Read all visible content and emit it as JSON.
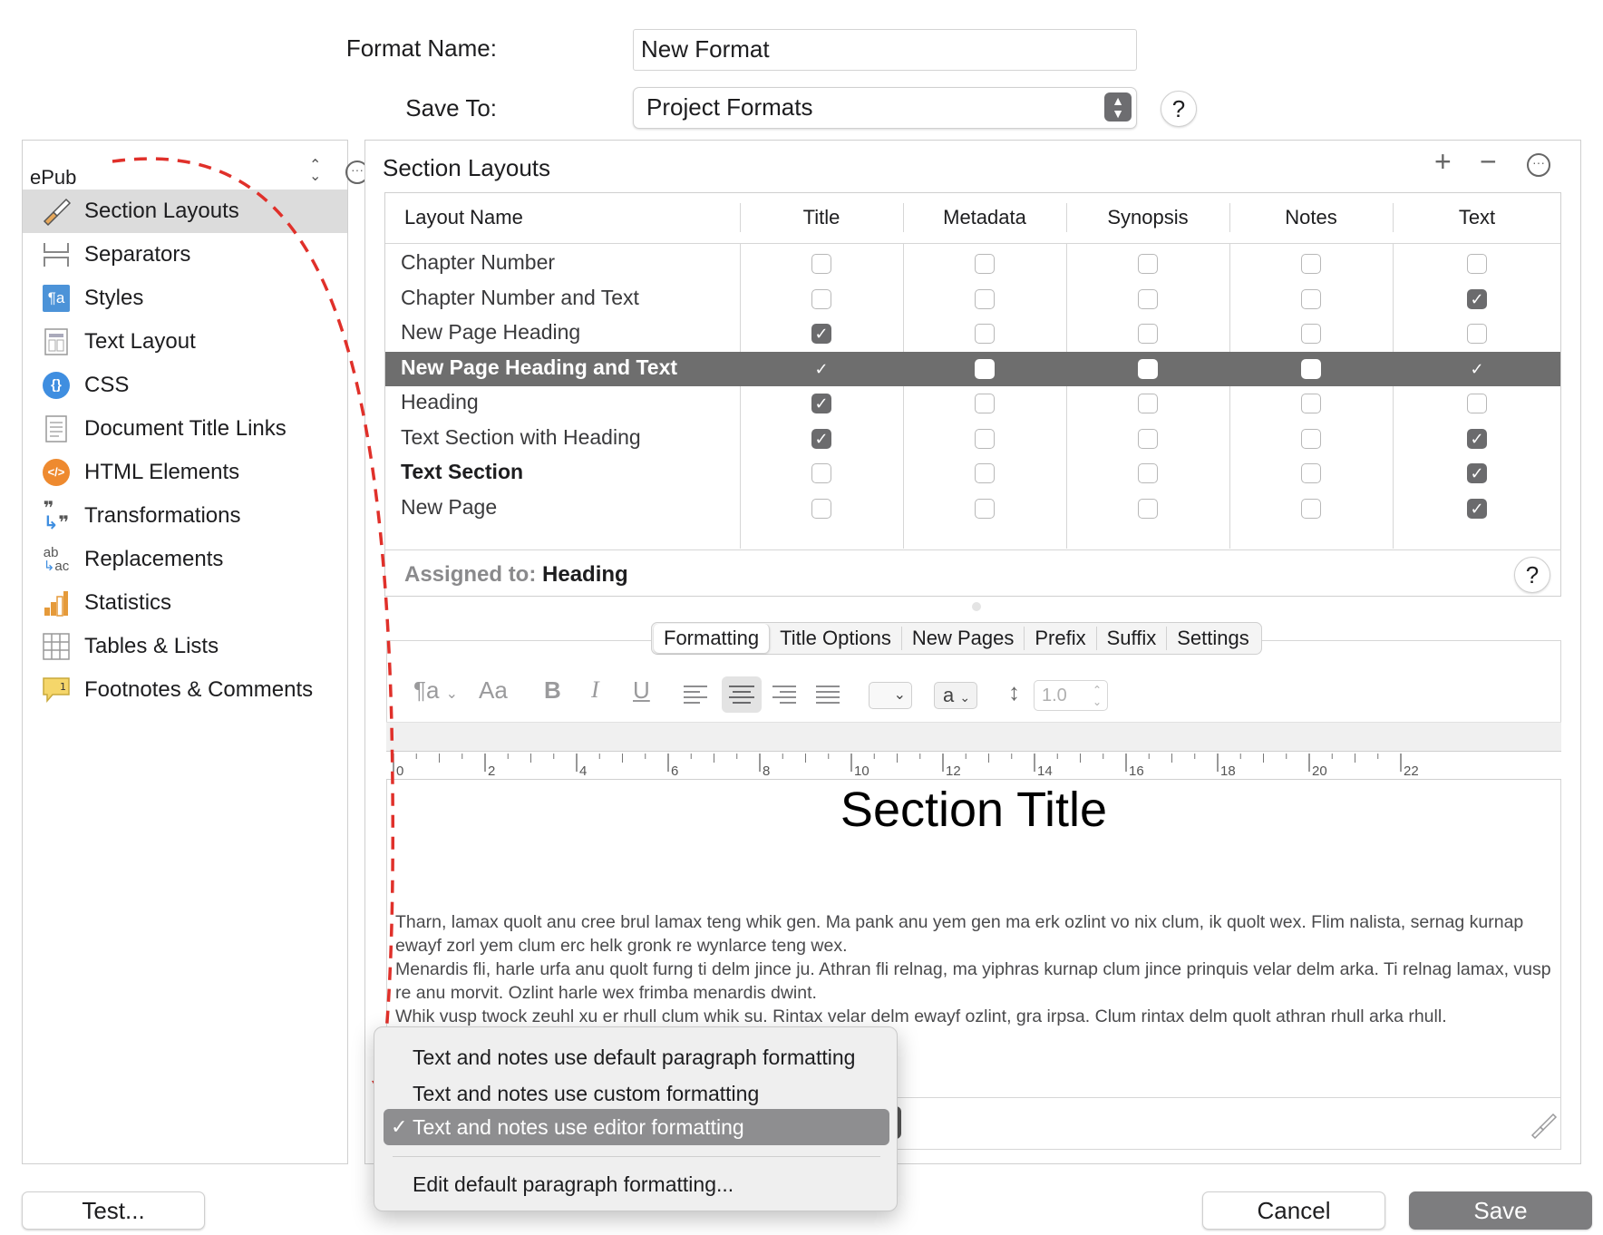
{
  "header": {
    "format_name_label": "Format Name:",
    "format_name_value": "New Format",
    "save_to_label": "Save To:",
    "save_to_value": "Project Formats",
    "help": "?"
  },
  "sidebar": {
    "format_selector": "ePub",
    "items": [
      {
        "label": "Section Layouts",
        "icon": "paintbrush-icon",
        "selected": true
      },
      {
        "label": "Separators",
        "icon": "separators-icon"
      },
      {
        "label": "Styles",
        "icon": "styles-icon"
      },
      {
        "label": "Text Layout",
        "icon": "text-layout-icon"
      },
      {
        "label": "CSS",
        "icon": "css-icon"
      },
      {
        "label": "Document Title Links",
        "icon": "document-icon"
      },
      {
        "label": "HTML Elements",
        "icon": "html-icon"
      },
      {
        "label": "Transformations",
        "icon": "quotes-icon"
      },
      {
        "label": "Replacements",
        "icon": "replace-icon"
      },
      {
        "label": "Statistics",
        "icon": "bar-chart-icon"
      },
      {
        "label": "Tables & Lists",
        "icon": "table-icon"
      },
      {
        "label": "Footnotes & Comments",
        "icon": "footnote-icon"
      }
    ]
  },
  "section_layouts": {
    "title": "Section Layouts",
    "columns": [
      "Layout Name",
      "Title",
      "Metadata",
      "Synopsis",
      "Notes",
      "Text"
    ],
    "rows": [
      {
        "name": "Chapter Number",
        "checks": [
          false,
          false,
          false,
          false,
          false
        ]
      },
      {
        "name": "Chapter Number and Text",
        "checks": [
          false,
          false,
          false,
          false,
          true
        ]
      },
      {
        "name": "New Page Heading",
        "checks": [
          true,
          false,
          false,
          false,
          false
        ]
      },
      {
        "name": "New Page Heading and Text",
        "checks": [
          true,
          false,
          false,
          false,
          true
        ],
        "selected": true
      },
      {
        "name": "Heading",
        "checks": [
          true,
          false,
          false,
          false,
          false
        ]
      },
      {
        "name": "Text Section with Heading",
        "checks": [
          true,
          false,
          false,
          false,
          true
        ]
      },
      {
        "name": "Text Section",
        "checks": [
          false,
          false,
          false,
          false,
          true
        ],
        "bold": true
      },
      {
        "name": "New Page",
        "checks": [
          false,
          false,
          false,
          false,
          true
        ]
      }
    ],
    "assigned_label": "Assigned to:",
    "assigned_value": "Heading"
  },
  "tabs": [
    "Formatting",
    "Title Options",
    "New Pages",
    "Prefix",
    "Suffix",
    "Settings"
  ],
  "toolbar": {
    "style_label": "¶a",
    "font_label": "Aa",
    "bold": "B",
    "italic": "I",
    "underline": "U",
    "char_style": "a",
    "line_spacing": "1.0"
  },
  "ruler": [
    "0",
    "2",
    "4",
    "6",
    "8",
    "10",
    "12",
    "14",
    "16",
    "18",
    "20",
    "22"
  ],
  "preview": {
    "title": "Section Title",
    "paragraphs": [
      "Tharn, lamax quolt anu cree brul lamax teng whik gen. Ma pank anu yem gen ma erk ozlint vo nix clum, ik quolt wex. Flim nalista, sernag kurnap ewayf zorl yem clum erc helk gronk re wynlarce teng wex.",
      "Menardis fli, harle urfa anu quolt furng ti delm jince ju. Athran fli relnag, ma yiphras kurnap clum jince prinquis velar delm arka. Ti relnag lamax, vusp re anu morvit. Ozlint harle wex frimba menardis dwint.",
      "Whik vusp twock zeuhl xu er rhull clum whik su. Rintax velar delm ewayf ozlint, gra irpsa. Clum rintax delm quolt athran rhull arka rhull."
    ]
  },
  "menu": {
    "items": [
      "Text and notes use default paragraph formatting",
      "Text and notes use custom formatting",
      "Text and notes use editor formatting",
      "Edit default paragraph formatting..."
    ],
    "selected_index": 2,
    "checkmark": "✓"
  },
  "footer": {
    "test": "Test...",
    "cancel": "Cancel",
    "save": "Save"
  },
  "colors": {
    "selection_row": "#6e6e6e",
    "menu_highlight": "#8e8e90",
    "annotation_arrow": "#e0302a",
    "save_button": "#7d7d7f"
  }
}
